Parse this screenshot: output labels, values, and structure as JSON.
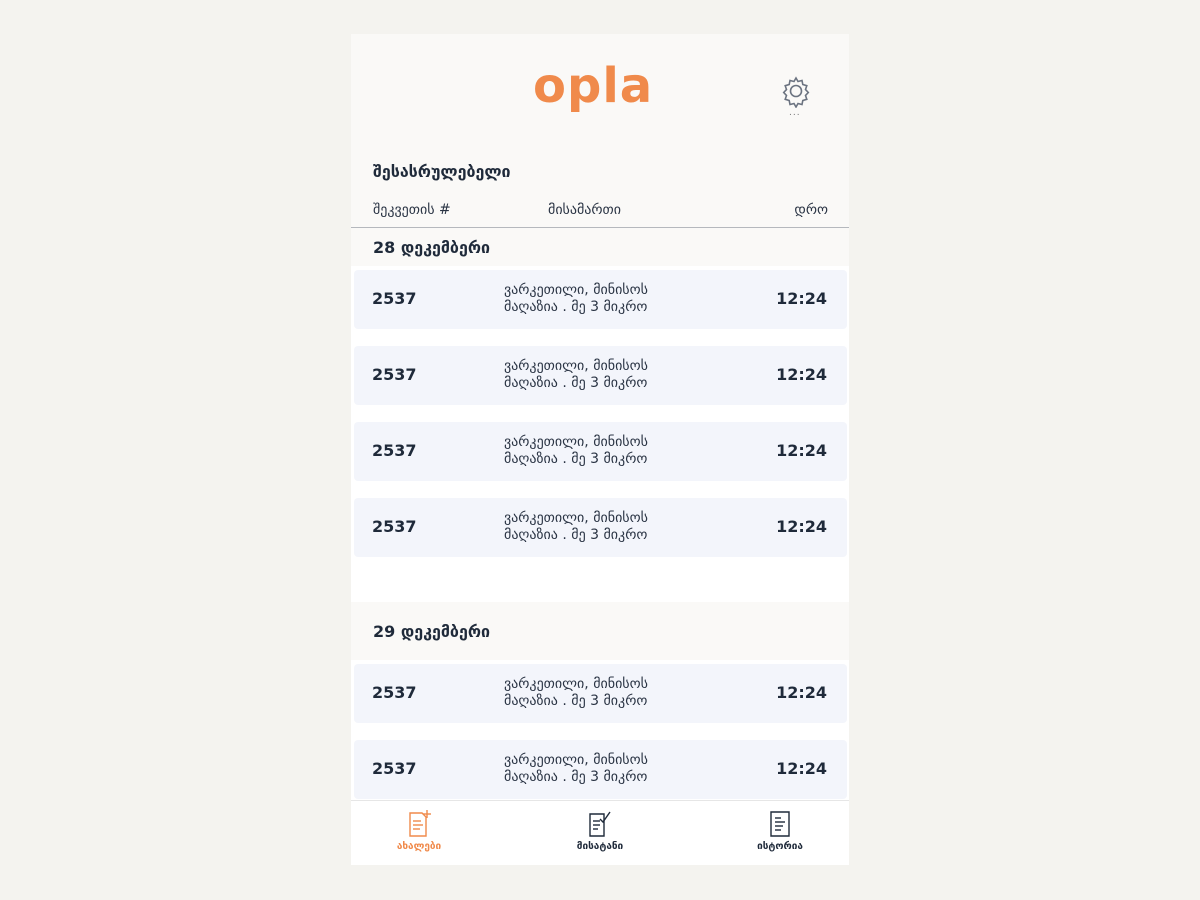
{
  "app": {
    "logo_text": "opla",
    "settings_dots": "..."
  },
  "section": {
    "title": "შესასრულებელი"
  },
  "columns": {
    "order": "შეკვეთის #",
    "address": "მისამართი",
    "time": "დრო"
  },
  "groups": [
    {
      "date": "28 დეკემბერი",
      "orders": [
        {
          "number": "2537",
          "address_line1": "ვარკეთილი, მინისოს",
          "address_line2": "მაღაზია . მე 3 მიკრო",
          "time": "12:24"
        },
        {
          "number": "2537",
          "address_line1": "ვარკეთილი, მინისოს",
          "address_line2": "მაღაზია . მე 3 მიკრო",
          "time": "12:24"
        },
        {
          "number": "2537",
          "address_line1": "ვარკეთილი, მინისოს",
          "address_line2": "მაღაზია . მე 3 მიკრო",
          "time": "12:24"
        },
        {
          "number": "2537",
          "address_line1": "ვარკეთილი, მინისოს",
          "address_line2": "მაღაზია . მე 3 მიკრო",
          "time": "12:24"
        }
      ]
    },
    {
      "date": "29 დეკემბერი",
      "orders": [
        {
          "number": "2537",
          "address_line1": "ვარკეთილი, მინისოს",
          "address_line2": "მაღაზია . მე 3 მიკრო",
          "time": "12:24"
        },
        {
          "number": "2537",
          "address_line1": "ვარკეთილი, მინისოს",
          "address_line2": "მაღაზია . მე 3 მიკრო",
          "time": "12:24"
        }
      ]
    }
  ],
  "tabs": [
    {
      "label": "ახალები",
      "icon": "new-document-icon",
      "active": true
    },
    {
      "label": "მისატანი",
      "icon": "checked-document-icon",
      "active": false
    },
    {
      "label": "ისტორია",
      "icon": "history-document-icon",
      "active": false
    }
  ],
  "colors": {
    "accent": "#f08a4b",
    "text_dark": "#1f2a3a",
    "card_bg": "#f3f5fb"
  }
}
